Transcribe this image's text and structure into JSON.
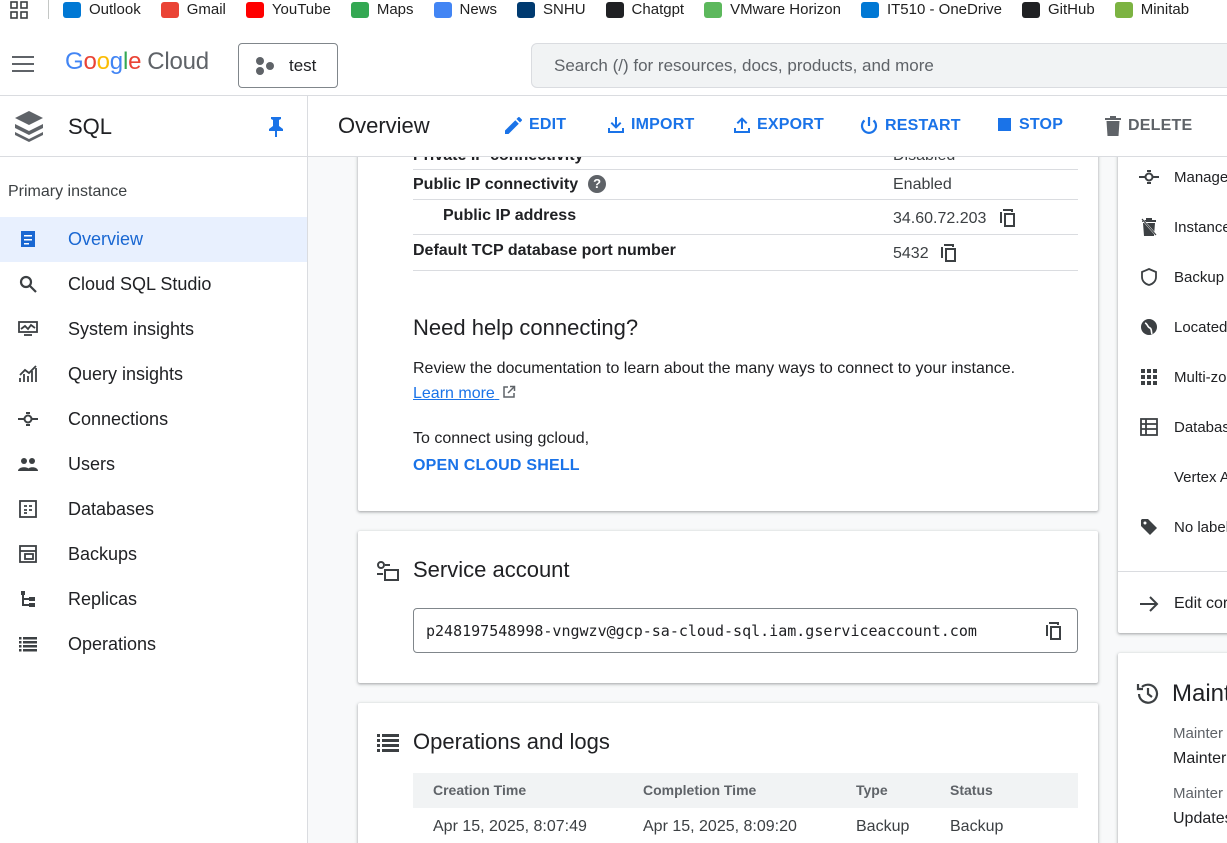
{
  "bookmarks": [
    {
      "label": "Outlook",
      "icon": "outlook-icon",
      "color": "#0078d4"
    },
    {
      "label": "Gmail",
      "icon": "gmail-icon",
      "color": "#ea4335"
    },
    {
      "label": "YouTube",
      "icon": "youtube-icon",
      "color": "#ff0000"
    },
    {
      "label": "Maps",
      "icon": "maps-icon",
      "color": "#34a853"
    },
    {
      "label": "News",
      "icon": "news-icon",
      "color": "#4285f4"
    },
    {
      "label": "SNHU",
      "icon": "snhu-icon",
      "color": "#003a70"
    },
    {
      "label": "Chatgpt",
      "icon": "chatgpt-icon",
      "color": "#202124"
    },
    {
      "label": "VMware Horizon",
      "icon": "vmware-icon",
      "color": "#5cb85c"
    },
    {
      "label": "IT510 - OneDrive",
      "icon": "onedrive-icon",
      "color": "#0078d4"
    },
    {
      "label": "GitHub",
      "icon": "github-icon",
      "color": "#202124"
    },
    {
      "label": "Minitab",
      "icon": "minitab-icon",
      "color": "#7cb342"
    }
  ],
  "header": {
    "logo_google": "Google",
    "logo_cloud": "Cloud",
    "project": "test",
    "search_placeholder": "Search (/) for resources, docs, products, and more"
  },
  "product": {
    "title": "SQL",
    "page_title": "Overview",
    "actions": {
      "edit": "EDIT",
      "import": "IMPORT",
      "export": "EXPORT",
      "restart": "RESTART",
      "stop": "STOP",
      "delete": "DELETE"
    }
  },
  "sidebar": {
    "heading": "Primary instance",
    "items": [
      {
        "label": "Overview",
        "icon": "overview-icon"
      },
      {
        "label": "Cloud SQL Studio",
        "icon": "search-icon"
      },
      {
        "label": "System insights",
        "icon": "monitor-icon"
      },
      {
        "label": "Query insights",
        "icon": "chart-icon"
      },
      {
        "label": "Connections",
        "icon": "connections-icon"
      },
      {
        "label": "Users",
        "icon": "users-icon"
      },
      {
        "label": "Databases",
        "icon": "databases-icon"
      },
      {
        "label": "Backups",
        "icon": "backups-icon"
      },
      {
        "label": "Replicas",
        "icon": "replicas-icon"
      },
      {
        "label": "Operations",
        "icon": "operations-icon"
      }
    ]
  },
  "connectivity": {
    "private_ip_label": "Private IP connectivity",
    "private_ip_value": "Disabled",
    "public_ip_label": "Public IP connectivity",
    "public_ip_value": "Enabled",
    "public_address_label": "Public IP address",
    "public_address_value": "34.60.72.203",
    "port_label": "Default TCP database port number",
    "port_value": "5432"
  },
  "help": {
    "title": "Need help connecting?",
    "text": "Review the documentation to learn about the many ways to connect to your instance.",
    "learn_more": "Learn more",
    "gcloud_text": "To connect using gcloud,",
    "shell_link": "OPEN CLOUD SHELL"
  },
  "service_account": {
    "title": "Service account",
    "value": "p248197548998-vngwzv@gcp-sa-cloud-sql.iam.gserviceaccount.com"
  },
  "operations": {
    "title": "Operations and logs",
    "columns": [
      "Creation Time",
      "Completion Time",
      "Type",
      "Status"
    ],
    "rows": [
      [
        "Apr 15, 2025, 8:07:49",
        "Apr 15, 2025, 8:09:20",
        "Backup",
        "Backup"
      ]
    ]
  },
  "right_panel": {
    "items": [
      {
        "label": "Manage",
        "icon": "connections-icon"
      },
      {
        "label": "Instance",
        "icon": "delete-protect-icon"
      },
      {
        "label": "Backup",
        "icon": "shield-icon"
      },
      {
        "label": "Located",
        "icon": "globe-icon"
      },
      {
        "label": "Multi-zo",
        "icon": "grid-icon"
      },
      {
        "label": "Databas",
        "icon": "table-icon"
      },
      {
        "label": "Vertex A",
        "icon": ""
      },
      {
        "label": "No label",
        "icon": "tag-icon"
      }
    ],
    "edit_label": "Edit cor",
    "maintenance_title": "Maint",
    "maint_label_1": "Mainter",
    "maint_value_1": "Mainter",
    "maint_label_2": "Mainter",
    "maint_value_2": "Updates"
  },
  "colors": {
    "accent": "#1a73e8",
    "active_bg": "#e8f0fe"
  }
}
